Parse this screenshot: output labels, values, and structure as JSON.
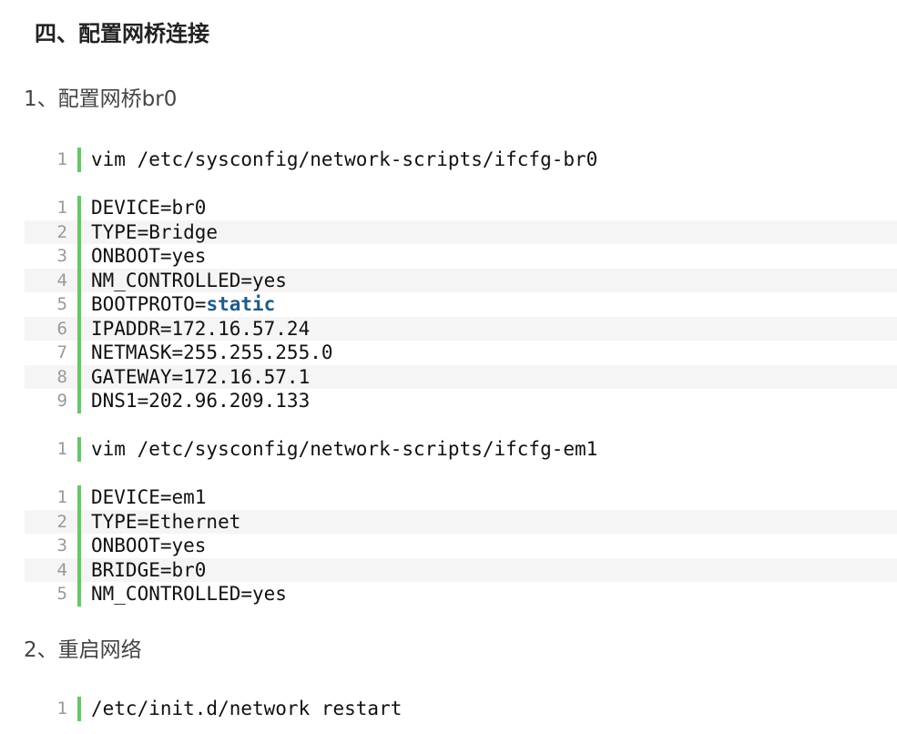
{
  "heading": "四、配置网桥连接",
  "step1": "1、配置网桥br0",
  "step2": "2、重启网络",
  "block_vim_br0": {
    "lines": [
      {
        "num": "1",
        "text": "vim /etc/sysconfig/network-scripts/ifcfg-br0"
      }
    ]
  },
  "block_br0_config": {
    "lines": [
      {
        "num": "1",
        "text": "DEVICE=br0"
      },
      {
        "num": "2",
        "text": "TYPE=Bridge"
      },
      {
        "num": "3",
        "text": "ONBOOT=yes"
      },
      {
        "num": "4",
        "text": "NM_CONTROLLED=yes"
      },
      {
        "num": "5",
        "text": "BOOTPROTO=",
        "keyword": "static"
      },
      {
        "num": "6",
        "text": "IPADDR=172.16.57.24"
      },
      {
        "num": "7",
        "text": "NETMASK=255.255.255.0"
      },
      {
        "num": "8",
        "text": "GATEWAY=172.16.57.1"
      },
      {
        "num": "9",
        "text": "DNS1=202.96.209.133"
      }
    ]
  },
  "block_vim_em1": {
    "lines": [
      {
        "num": "1",
        "text": "vim /etc/sysconfig/network-scripts/ifcfg-em1"
      }
    ]
  },
  "block_em1_config": {
    "lines": [
      {
        "num": "1",
        "text": "DEVICE=em1"
      },
      {
        "num": "2",
        "text": "TYPE=Ethernet"
      },
      {
        "num": "3",
        "text": "ONBOOT=yes"
      },
      {
        "num": "4",
        "text": "BRIDGE=br0"
      },
      {
        "num": "5",
        "text": "NM_CONTROLLED=yes"
      }
    ]
  },
  "block_restart": {
    "lines": [
      {
        "num": "1",
        "text": "/etc/init.d/network restart"
      }
    ]
  },
  "colors": {
    "gutter": "#6cc36c",
    "keyword": "#1f5c8a",
    "stripe": "#f5f5f5"
  }
}
